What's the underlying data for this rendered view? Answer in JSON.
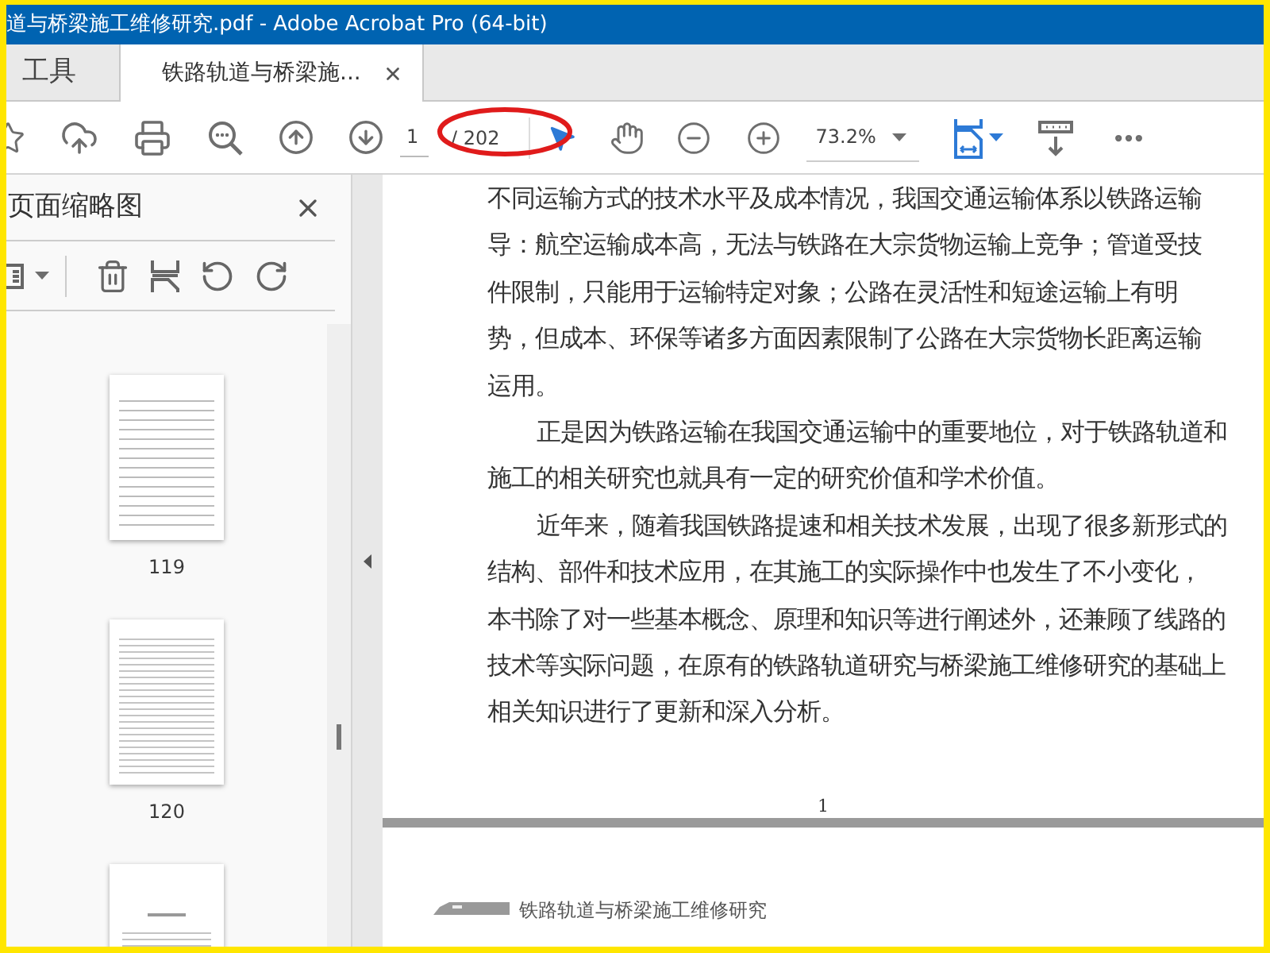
{
  "window": {
    "title": "道与桥梁施工维修研究.pdf - Adobe Acrobat Pro (64-bit)"
  },
  "tabs": [
    {
      "label": "工具",
      "selected": false
    },
    {
      "label": "铁路轨道与桥梁施...",
      "selected": true
    }
  ],
  "toolbar": {
    "page_number": "1",
    "page_count": "/ 202",
    "zoom": "73.2%",
    "tools": [
      {
        "kind": "select",
        "selected": true
      },
      {
        "kind": "hand",
        "selected": false
      }
    ]
  },
  "sidebar": {
    "title": "页面缩略图",
    "thumbnails": [
      {
        "label": "119",
        "kind": "table"
      },
      {
        "label": "120",
        "kind": "text"
      },
      {
        "kind": "chapter"
      }
    ]
  },
  "document": {
    "lines": [
      {
        "text": "不同运输方式的技术水平及成本情况，我国交通运输体系以铁路运输",
        "indent": false
      },
      {
        "text": "导：航空运输成本高，无法与铁路在大宗货物运输上竞争；管道受技",
        "indent": false
      },
      {
        "text": "件限制，只能用于运输特定对象；公路在灵活性和短途运输上有明",
        "indent": false
      },
      {
        "text": "势，但成本、环保等诸多方面因素限制了公路在大宗货物长距离运输",
        "indent": false
      },
      {
        "text": "运用。",
        "indent": false
      },
      {
        "text": "正是因为铁路运输在我国交通运输中的重要地位，对于铁路轨道和",
        "indent": true
      },
      {
        "text": "施工的相关研究也就具有一定的研究价值和学术价值。",
        "indent": false
      },
      {
        "text": "近年来，随着我国铁路提速和相关技术发展，出现了很多新形式的",
        "indent": true
      },
      {
        "text": "结构、部件和技术应用，在其施工的实际操作中也发生了不小变化，",
        "indent": false
      },
      {
        "text": "本书除了对一些基本概念、原理和知识等进行阐述外，还兼顾了线路的",
        "indent": false
      },
      {
        "text": "技术等实际问题，在原有的铁路轨道研究与桥梁施工维修研究的基础上",
        "indent": false
      },
      {
        "text": "相关知识进行了更新和深入分析。",
        "indent": false
      }
    ],
    "page_number": "1",
    "next_page_header": "铁路轨道与桥梁施工维修研究"
  }
}
